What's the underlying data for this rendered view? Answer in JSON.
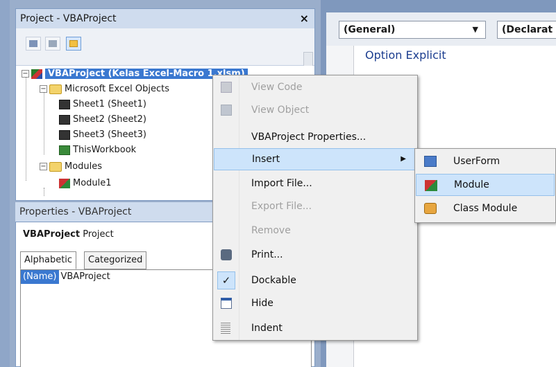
{
  "project_explorer": {
    "title": "Project - VBAProject",
    "close_glyph": "×",
    "tree": {
      "root": "VBAProject (Kelas Excel-Macro 1.xlsm)",
      "excel_objects_folder": "Microsoft Excel Objects",
      "sheets": [
        "Sheet1 (Sheet1)",
        "Sheet2 (Sheet2)",
        "Sheet3 (Sheet3)"
      ],
      "workbook": "ThisWorkbook",
      "modules_folder": "Modules",
      "module": "Module1"
    }
  },
  "properties": {
    "title": "Properties - VBAProject",
    "object_name": "VBAProject",
    "object_type": "Project",
    "tabs": [
      "Alphabetic",
      "Categorized"
    ],
    "row_name": "(Name)",
    "row_value": "VBAProject"
  },
  "code_window": {
    "object_dropdown": "(General)",
    "proc_dropdown": "(Declarat",
    "code_line": "Option Explicit"
  },
  "context_menu": {
    "items": [
      {
        "label": "View Code",
        "enabled": false
      },
      {
        "label": "View Object",
        "enabled": false
      },
      {
        "label": "VBAProject Properties...",
        "enabled": true
      },
      {
        "label": "Insert",
        "enabled": true
      },
      {
        "label": "Import File...",
        "enabled": true
      },
      {
        "label": "Export File...",
        "enabled": false
      },
      {
        "label": "Remove",
        "enabled": false
      },
      {
        "label": "Print...",
        "enabled": true
      },
      {
        "label": "Dockable",
        "enabled": true,
        "checked": true
      },
      {
        "label": "Hide",
        "enabled": true
      },
      {
        "label": "Indent",
        "enabled": true
      }
    ]
  },
  "insert_submenu": {
    "items": [
      "UserForm",
      "Module",
      "Class Module"
    ]
  },
  "icons": {
    "check": "✓",
    "submenu_arrow": "▶",
    "dropdown_arrow": "▼",
    "tree_expand": "−"
  },
  "colors": {
    "selection": "#3a78d0",
    "menu_hover": "#cde4fb",
    "code_text": "#1b3d8f"
  }
}
